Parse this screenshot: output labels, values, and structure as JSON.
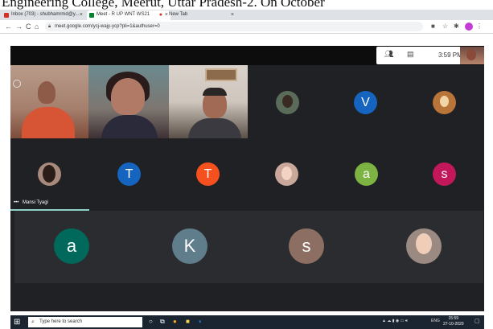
{
  "banner": {
    "text": "Engineering College, Meerut, Uttar Pradesh-2. On October"
  },
  "browser": {
    "tabs": [
      {
        "label": "Inbox (703) - shubhamrmd@y..."
      },
      {
        "label": "Meet - R UP WNT WS21"
      },
      {
        "label": "New Tab"
      }
    ],
    "url": "meet.google.com/ycj-wajy-ycp?pli=1&authuser=0",
    "window_controls": [
      "−",
      "□",
      "✕"
    ]
  },
  "meet": {
    "clock": "3:59 PM",
    "participants_icon": "people-icon",
    "chat_icon": "chat-icon",
    "avatars_row2_top": [
      "V"
    ],
    "avatars_row2": [
      "T",
      "T",
      "a",
      "s"
    ],
    "avatars_bottom": [
      "a",
      "K",
      "s"
    ],
    "speaker_name": "Mansi Tyagi",
    "colors": {
      "avatar_blue": "#1565c0",
      "avatar_orange": "#f4511e",
      "avatar_green": "#7cb342",
      "avatar_magenta": "#c2185b",
      "avatar_darkgreen": "#00695c",
      "avatar_slate": "#607d8b",
      "avatar_brown": "#8d6e63",
      "speak_bar": "#8ed2c7"
    }
  },
  "taskbar": {
    "search_placeholder": "Type here to search",
    "time": "15:59",
    "date": "27-10-2020",
    "lang": "ENG"
  }
}
